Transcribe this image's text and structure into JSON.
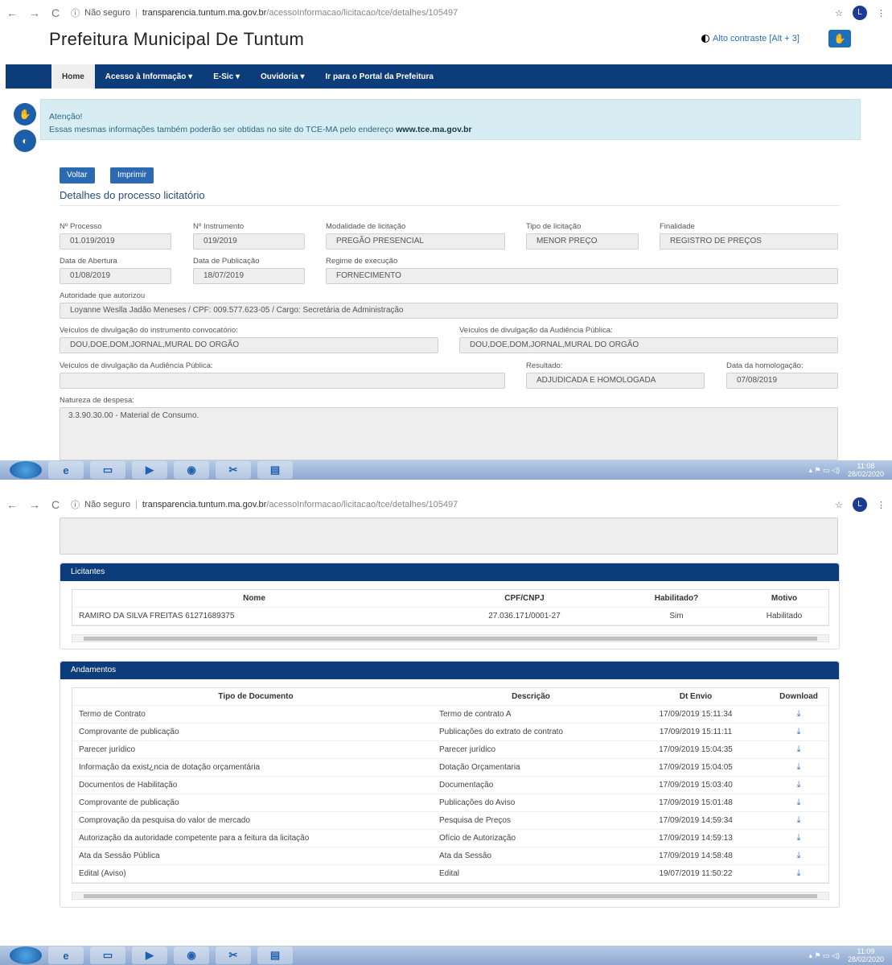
{
  "browser": {
    "security": "Não seguro",
    "url_host": "transparencia.tuntum.ma.gov.br",
    "url_path": "/acessoInformacao/licitacao/tce/detalhes/105497",
    "avatar": "L"
  },
  "site": {
    "title": "Prefeitura Municipal De Tuntum",
    "contrast_link": "Alto contraste [Alt + 3]"
  },
  "nav": {
    "items": [
      "Home",
      "Acesso à Informação ▾",
      "E-Sic ▾",
      "Ouvidoria ▾",
      "Ir para o Portal da Prefeitura"
    ]
  },
  "alert": {
    "title": "Atenção!",
    "text": "Essas mesmas informações também poderão ser obtidas no site do TCE-MA pelo endereço",
    "link": "www.tce.ma.gov.br"
  },
  "buttons": {
    "back": "Voltar",
    "print": "Imprimir"
  },
  "section_title": "Detalhes do processo licitatório",
  "fields": {
    "processo": {
      "label": "Nº Processo",
      "value": "01.019/2019"
    },
    "instrumento": {
      "label": "Nº Instrumento",
      "value": "019/2019"
    },
    "modalidade": {
      "label": "Modalidade de licitação",
      "value": "PREGÃO PRESENCIAL"
    },
    "tipo": {
      "label": "Tipo de licitação",
      "value": "MENOR PREÇO"
    },
    "finalidade": {
      "label": "Finalidade",
      "value": "REGISTRO DE PREÇOS"
    },
    "abertura": {
      "label": "Data de Abertura",
      "value": "01/08/2019"
    },
    "publicacao": {
      "label": "Data de Publicação",
      "value": "18/07/2019"
    },
    "regime": {
      "label": "Regime de execução",
      "value": "FORNECIMENTO"
    },
    "autoridade": {
      "label": "Autoridade que autorizou",
      "value": "Loyanne Weslla Jadão Meneses / CPF: 009.577.623-05 / Cargo: Secretária de Administração"
    },
    "veiculos_instrumento": {
      "label": "Veículos de divulgação do instrumento convocatório:",
      "value": "DOU,DOE,DOM,JORNAL,MURAL DO ORGÃO"
    },
    "veiculos_audiencia": {
      "label": "Veículos de divulgação da Audiência Pública:",
      "value": "DOU,DOE,DOM,JORNAL,MURAL DO ORGÃO"
    },
    "veiculos_audiencia2": {
      "label": "Veículos de divulgação da Audiência Pública:",
      "value": ""
    },
    "resultado": {
      "label": "Resultado:",
      "value": "ADJUDICADA E HOMOLOGADA"
    },
    "homologacao": {
      "label": "Data da homologação:",
      "value": "07/08/2019"
    },
    "natureza": {
      "label": "Natureza de despesa:",
      "value": "3.3.90.30.00 - Material de Consumo."
    }
  },
  "licitantes": {
    "title": "Licitantes",
    "headers": [
      "Nome",
      "CPF/CNPJ",
      "Habilitado?",
      "Motivo"
    ],
    "rows": [
      [
        "RAMIRO DA SILVA FREITAS 61271689375",
        "27.036.171/0001-27",
        "Sim",
        "Habilitado"
      ]
    ]
  },
  "andamentos": {
    "title": "Andamentos",
    "headers": [
      "Tipo de Documento",
      "Descrição",
      "Dt Envio",
      "Download"
    ],
    "rows": [
      [
        "Termo de Contrato",
        "Termo de contrato A",
        "17/09/2019 15:11:34"
      ],
      [
        "Comprovante de publicação",
        "Publicações do extrato de contrato",
        "17/09/2019 15:11:11"
      ],
      [
        "Parecer jurídico",
        "Parecer jurídico",
        "17/09/2019 15:04:35"
      ],
      [
        "Informação da exist¿ncia de dotação orçamentária",
        "Dotação Orçamentaria",
        "17/09/2019 15:04:05"
      ],
      [
        "Documentos de Habilitação",
        "Documentação",
        "17/09/2019 15:03:40"
      ],
      [
        "Comprovante de publicação",
        "Publicações do Aviso",
        "17/09/2019 15:01:48"
      ],
      [
        "Comprovação da pesquisa do valor de mercado",
        "Pesquisa de Preços",
        "17/09/2019 14:59:34"
      ],
      [
        "Autorização da autoridade competente para a feitura da licitação",
        "Ofício de Autorização",
        "17/09/2019 14:59:13"
      ],
      [
        "Ata da Sessão Pública",
        "Ata da Sessão",
        "17/09/2019 14:58:48"
      ],
      [
        "Edital (Aviso)",
        "Edital",
        "19/07/2019 11:50:22"
      ]
    ]
  },
  "taskbar": {
    "clock1_time": "11:08",
    "clock1_date": "28/02/2020",
    "clock2_time": "11:09",
    "clock2_date": "28/02/2020"
  },
  "icons": [
    "back-icon",
    "forward-icon",
    "reload-icon",
    "info-icon",
    "star-icon",
    "menu-icon",
    "libras-icon",
    "contrast-icon",
    "download-icon"
  ]
}
